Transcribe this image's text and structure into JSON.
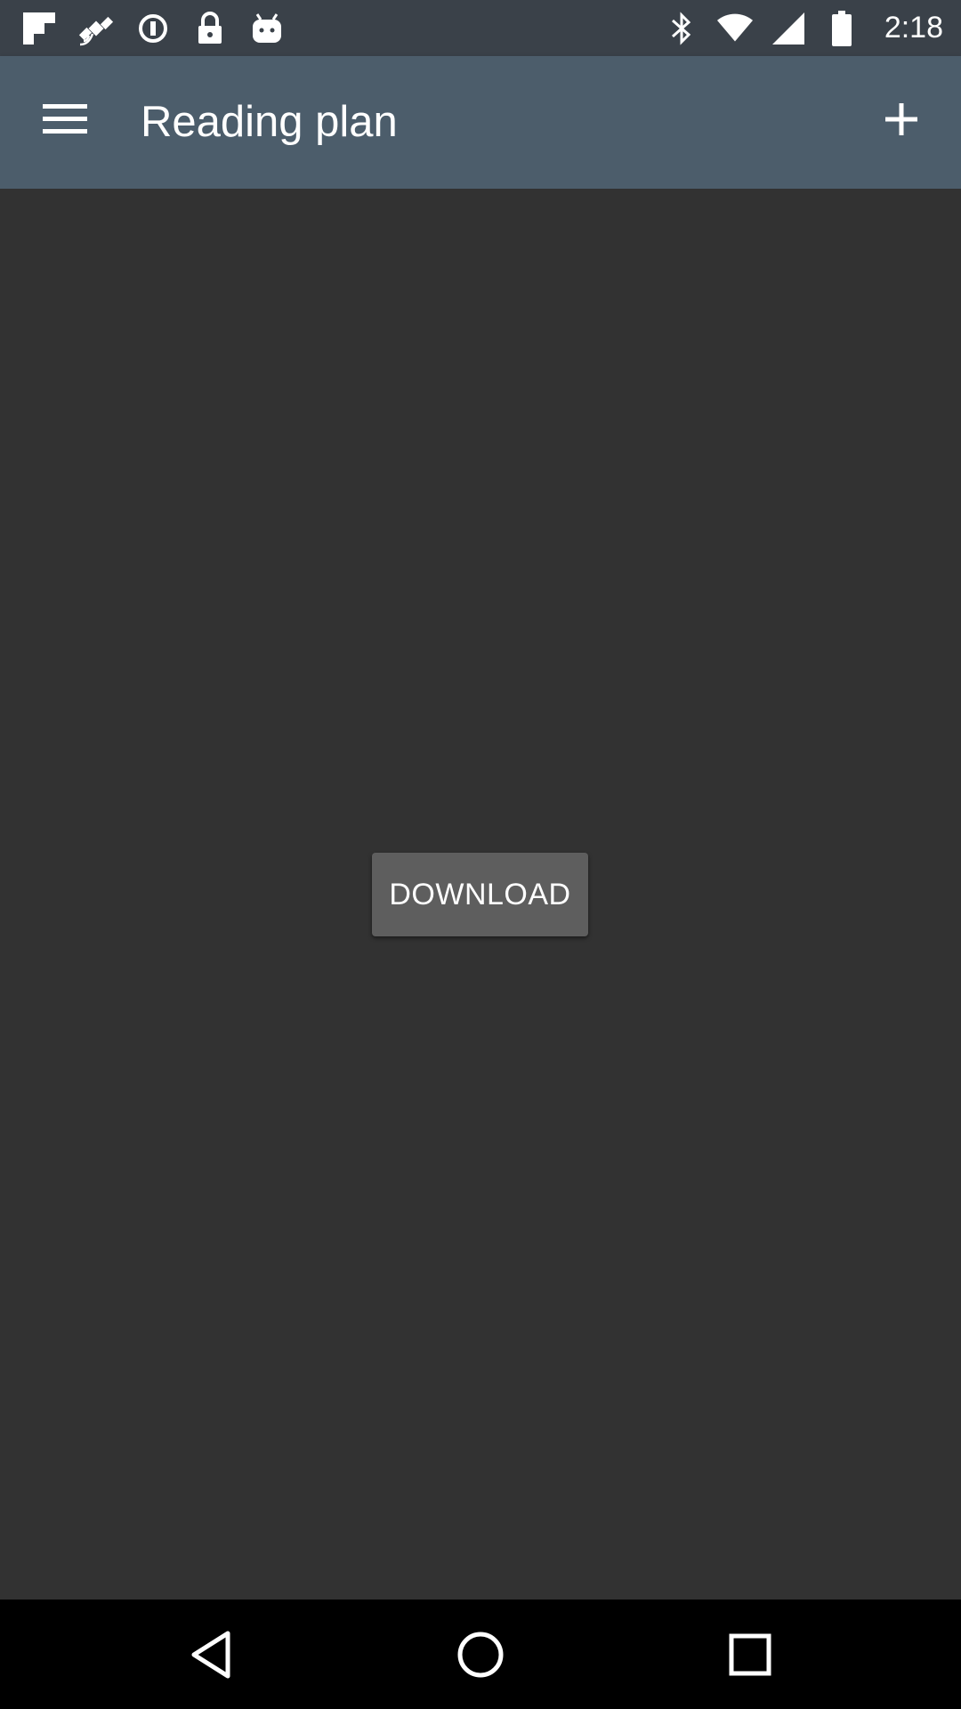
{
  "status_bar": {
    "time": "2:18",
    "left_icons": [
      "flipboard-icon",
      "fake-gps-satellite-icon",
      "data-saver-icon",
      "lock-icon",
      "android-icon"
    ],
    "right_icons": [
      "bluetooth-icon",
      "wifi-icon",
      "signal-icon",
      "battery-icon"
    ]
  },
  "app_bar": {
    "title": "Reading plan",
    "menu_icon": "hamburger-menu-icon",
    "action_icon": "plus-icon",
    "background": "#4c5d6b"
  },
  "content": {
    "download_label": "DOWNLOAD",
    "background": "#323232"
  },
  "nav_bar": {
    "buttons": [
      "back-icon",
      "home-icon",
      "recents-icon"
    ]
  }
}
